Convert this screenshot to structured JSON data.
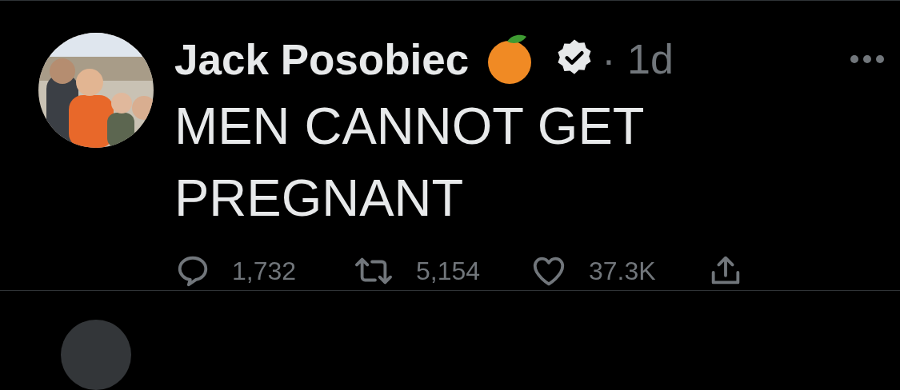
{
  "tweet": {
    "author": "Jack Posobiec",
    "verified": true,
    "time": "· 1d",
    "text": "MEN CANNOT GET PREGNANT",
    "actions": [
      {
        "kind": "reply",
        "count": "1,732"
      },
      {
        "kind": "retweet",
        "count": "5,154"
      },
      {
        "kind": "like",
        "count": "37.3K"
      },
      {
        "kind": "share"
      }
    ]
  }
}
